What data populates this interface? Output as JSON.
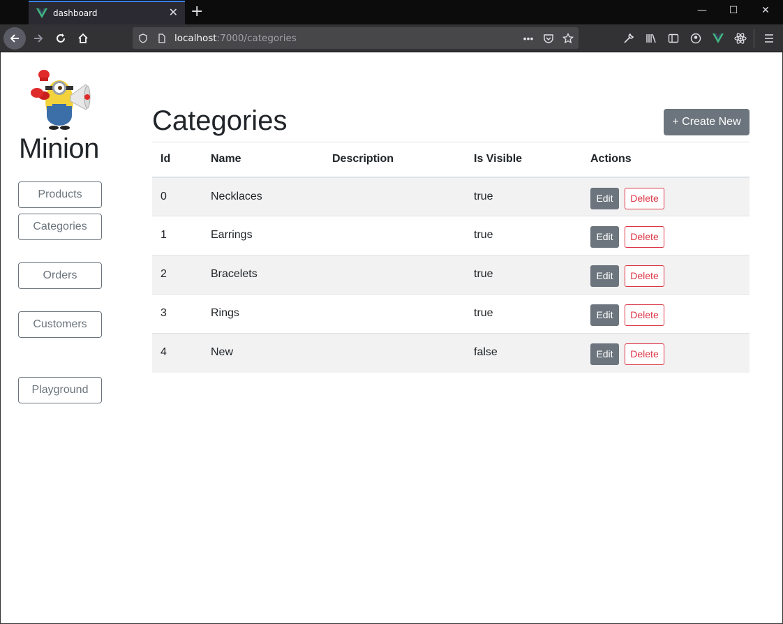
{
  "browser": {
    "tab_title": "dashboard",
    "new_tab": "+",
    "url_host": "localhost",
    "url_rest": ":7000/categories",
    "window_controls": {
      "minimize": "—",
      "maximize": "☐",
      "close": "✕"
    }
  },
  "sidebar": {
    "brand": "Minion",
    "items": [
      {
        "label": "Products"
      },
      {
        "label": "Categories"
      },
      {
        "label": "Orders"
      },
      {
        "label": "Customers"
      },
      {
        "label": "Playground"
      }
    ]
  },
  "main": {
    "title": "Categories",
    "create_label": "+ Create New",
    "columns": [
      "Id",
      "Name",
      "Description",
      "Is Visible",
      "Actions"
    ],
    "rows": [
      {
        "id": "0",
        "name": "Necklaces",
        "description": "",
        "visible": "true"
      },
      {
        "id": "1",
        "name": "Earrings",
        "description": "",
        "visible": "true"
      },
      {
        "id": "2",
        "name": "Bracelets",
        "description": "",
        "visible": "true"
      },
      {
        "id": "3",
        "name": "Rings",
        "description": "",
        "visible": "true"
      },
      {
        "id": "4",
        "name": "New",
        "description": "",
        "visible": "false"
      }
    ],
    "edit_label": "Edit",
    "delete_label": "Delete"
  },
  "colors": {
    "secondary": "#6c757d",
    "danger": "#dc3545",
    "vue_green": "#41b883",
    "tab_accent": "#3b82f6"
  }
}
